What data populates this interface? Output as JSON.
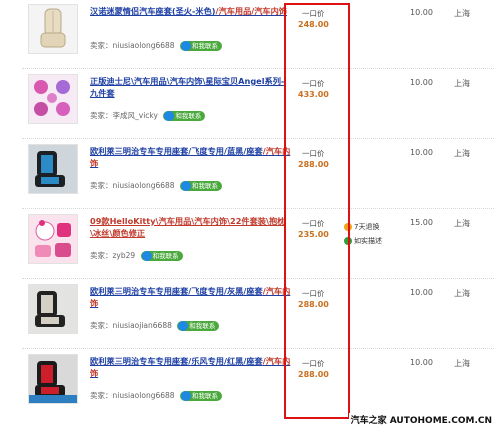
{
  "listings": [
    {
      "title_main": "汉诺迷蒙情侣汽车座套(圣火-米色)",
      "title_cat": "/汽车用品/汽车内饰",
      "seller_label": "卖家：",
      "seller": "niusiaolong6688",
      "contact": "和我联系",
      "price_type": "一口价",
      "price": "248.00",
      "shipping": "10.00",
      "location": "上海",
      "thumb_icon": "car-seat-cushion-beige"
    },
    {
      "title_main": "正版迪士尼\\汽车用品\\汽车内饰\\星际宝贝Angel系列-九件套",
      "title_cat": "",
      "seller_label": "卖家：",
      "seller": "李成风_vicky",
      "contact": "和我联系",
      "price_type": "一口价",
      "price": "433.00",
      "shipping": "10.00",
      "location": "上海",
      "thumb_icon": "pink-accessory-set"
    },
    {
      "title_main": "欧利莱三明治专车专用座套/飞度专用/蓝黑/座套",
      "title_cat": "/汽车内饰",
      "seller_label": "卖家：",
      "seller": "niusiaolong6688",
      "contact": "和我联系",
      "price_type": "一口价",
      "price": "288.00",
      "shipping": "10.00",
      "location": "上海",
      "thumb_icon": "car-seat-blue-black"
    },
    {
      "title_main": "09款HelloKitty\\汽车用品\\汽车内饰\\22件套装\\抱枕\\冰丝\\颜色修正",
      "title_cat": "",
      "seller_label": "卖家：",
      "seller": "zyb29",
      "contact": "和我联系",
      "price_type": "一口价",
      "price": "235.00",
      "shipping": "15.00",
      "location": "上海",
      "services": [
        "7天退换",
        "如实描述"
      ],
      "thumb_icon": "hello-kitty-set"
    },
    {
      "title_main": "欧利莱三明治专车专用座套/飞度专用/灰黑/座套",
      "title_cat": "/汽车内饰",
      "seller_label": "卖家：",
      "seller": "niusiaojian6688",
      "contact": "和我联系",
      "price_type": "一口价",
      "price": "288.00",
      "shipping": "10.00",
      "location": "上海",
      "thumb_icon": "car-seat-grey-black"
    },
    {
      "title_main": "欧利莱三明治专车专用座套/乐风专用/红黑/座套",
      "title_cat": "/汽车内饰",
      "seller_label": "卖家：",
      "seller": "niusiaolong6688",
      "contact": "和我联系",
      "price_type": "一口价",
      "price": "288.00",
      "shipping": "10.00",
      "location": "上海",
      "thumb_icon": "car-seat-red-black"
    }
  ],
  "watermark": {
    "cn": "汽车之家",
    "en": "AUTOHOME.COM.CN"
  },
  "colors": {
    "title_link": "#1d3fa3",
    "category": "#c0392b",
    "price": "#c87020",
    "highlight_box": "#dd1111",
    "im_badge": "#4aa83d"
  }
}
